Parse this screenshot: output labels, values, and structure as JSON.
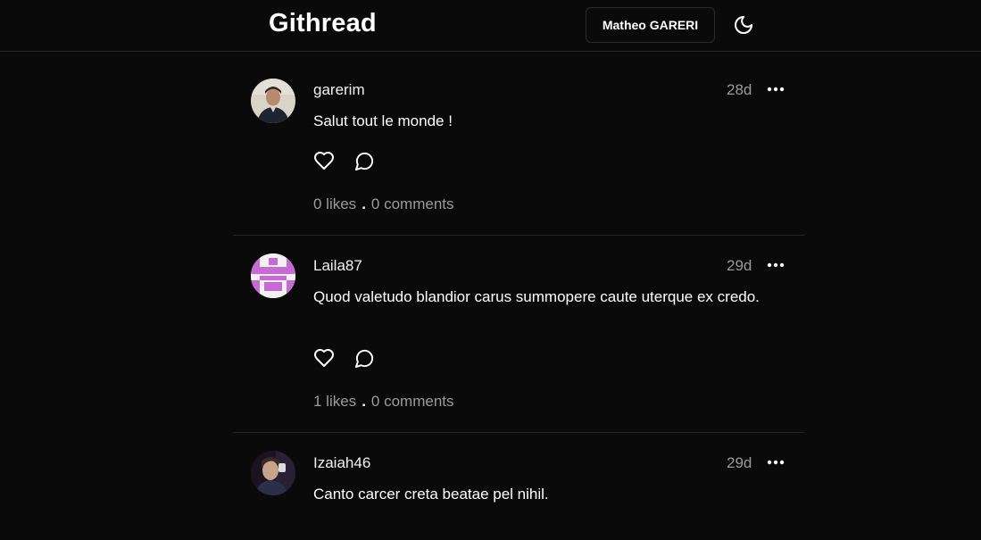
{
  "app": {
    "title": "Githread",
    "user_button": "Matheo GARERI",
    "theme_icon": "moon-icon"
  },
  "posts": [
    {
      "username": "garerim",
      "time": "28d",
      "content": "Salut tout le monde !",
      "likes": "0 likes",
      "separator": ".",
      "comments": "0 comments",
      "avatar": "photo-avatar"
    },
    {
      "username": "Laila87",
      "time": "29d",
      "content": "Quod valetudo blandior carus summopere caute uterque ex credo.",
      "likes": "1 likes",
      "separator": ".",
      "comments": "0 comments",
      "avatar": "identicon-avatar",
      "avatar_color": "#c86ad6"
    },
    {
      "username": "Izaiah46",
      "time": "29d",
      "content": "Canto carcer creta beatae pel nihil.",
      "avatar": "photo-avatar"
    }
  ],
  "colors": {
    "background": "#0a0a0a",
    "muted_text": "#9a9a9a",
    "divider": "#262626"
  }
}
